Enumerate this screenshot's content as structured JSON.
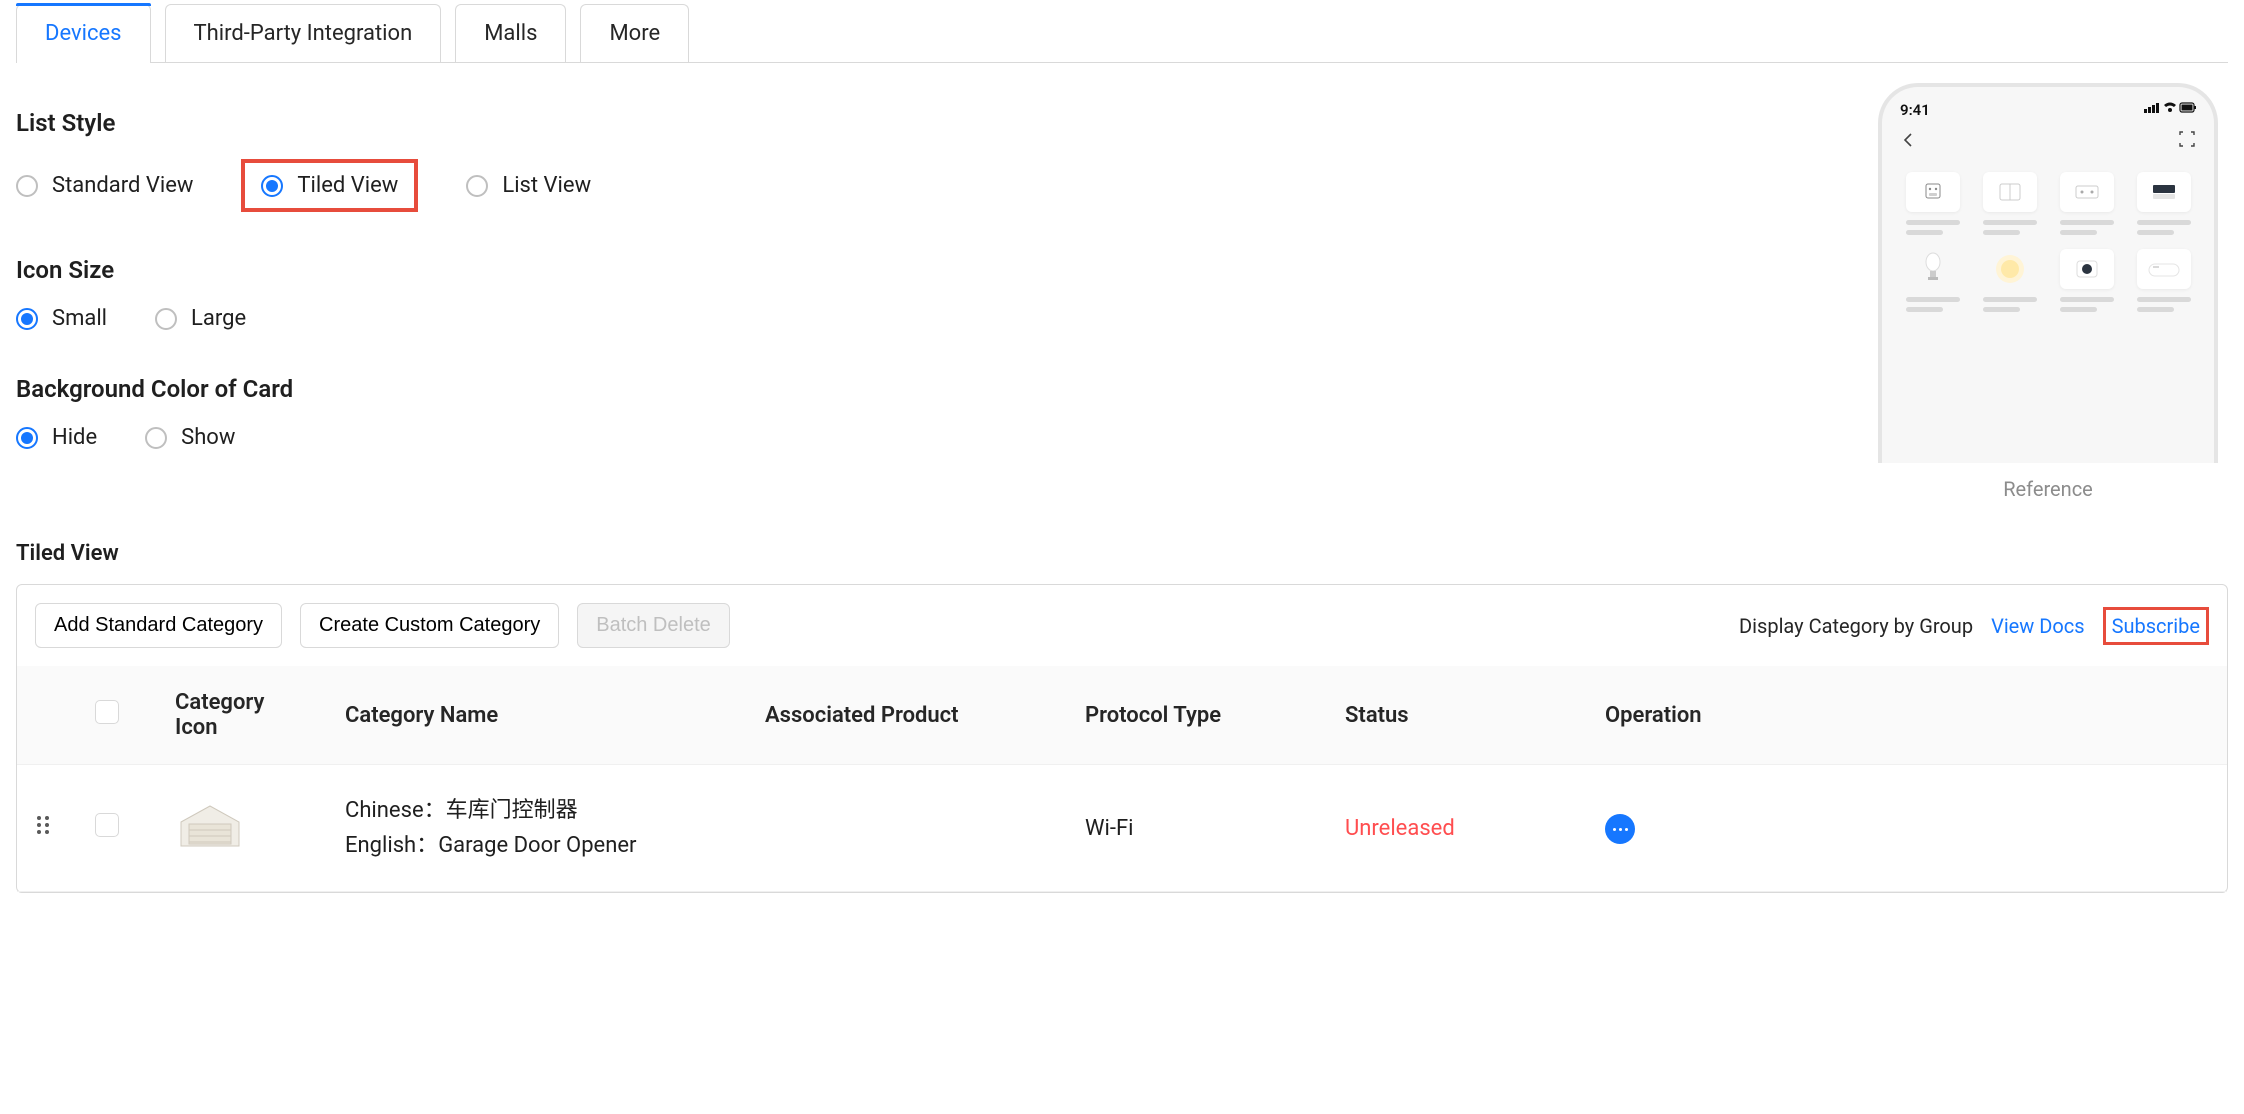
{
  "tabs": [
    {
      "label": "Devices",
      "active": true
    },
    {
      "label": "Third-Party Integration",
      "active": false
    },
    {
      "label": "Malls",
      "active": false
    },
    {
      "label": "More",
      "active": false
    }
  ],
  "listStyle": {
    "title": "List Style",
    "options": [
      {
        "label": "Standard View",
        "selected": false,
        "highlight": false
      },
      {
        "label": "Tiled View",
        "selected": true,
        "highlight": true
      },
      {
        "label": "List View",
        "selected": false,
        "highlight": false
      }
    ]
  },
  "iconSize": {
    "title": "Icon Size",
    "options": [
      {
        "label": "Small",
        "selected": true
      },
      {
        "label": "Large",
        "selected": false
      }
    ]
  },
  "cardBg": {
    "title": "Background Color of Card",
    "options": [
      {
        "label": "Hide",
        "selected": true
      },
      {
        "label": "Show",
        "selected": false
      }
    ]
  },
  "preview": {
    "time": "9:41",
    "caption": "Reference"
  },
  "tiledView": {
    "title": "Tiled View",
    "toolbar": {
      "add": "Add Standard Category",
      "create": "Create Custom Category",
      "batchDelete": "Batch Delete",
      "displayLabel": "Display Category by Group",
      "viewDocs": "View Docs",
      "subscribe": "Subscribe"
    },
    "columns": {
      "icon": "Category Icon",
      "name": "Category Name",
      "assoc": "Associated Product",
      "protocol": "Protocol Type",
      "status": "Status",
      "operation": "Operation"
    },
    "rows": [
      {
        "name_cn_label": "Chinese：",
        "name_cn": "车库门控制器",
        "name_en_label": "English：",
        "name_en": "Garage Door Opener",
        "assoc": "",
        "protocol": "Wi-Fi",
        "status": "Unreleased"
      }
    ]
  }
}
